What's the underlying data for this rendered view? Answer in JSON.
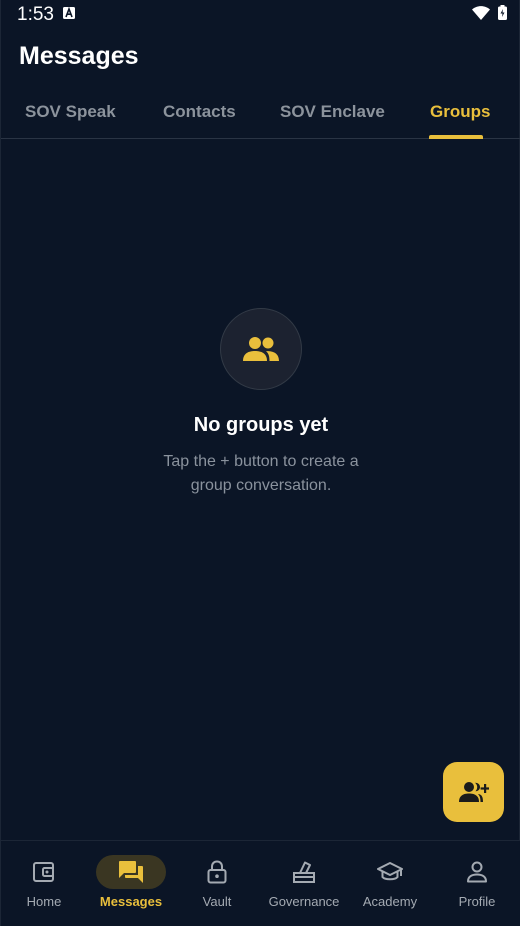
{
  "status_bar": {
    "time": "1:53",
    "icons": [
      "a-notification-icon",
      "wifi-icon",
      "battery-icon"
    ]
  },
  "header": {
    "title": "Messages"
  },
  "tabs": [
    {
      "label": "SOV Speak",
      "active": false
    },
    {
      "label": "Contacts",
      "active": false
    },
    {
      "label": "SOV Enclave",
      "active": false
    },
    {
      "label": "Groups",
      "active": true
    }
  ],
  "empty_state": {
    "icon": "groups-icon",
    "title": "No groups yet",
    "subtitle": "Tap the + button to create a group conversation."
  },
  "fab": {
    "icon": "add-group-icon"
  },
  "bottom_nav": [
    {
      "label": "Home",
      "icon": "wallet-icon",
      "active": false
    },
    {
      "label": "Messages",
      "icon": "chat-icon",
      "active": true
    },
    {
      "label": "Vault",
      "icon": "lock-icon",
      "active": false
    },
    {
      "label": "Governance",
      "icon": "vote-icon",
      "active": false
    },
    {
      "label": "Academy",
      "icon": "graduation-cap-icon",
      "active": false
    },
    {
      "label": "Profile",
      "icon": "person-icon",
      "active": false
    }
  ],
  "colors": {
    "background": "#0b1526",
    "accent": "#e9bf3c",
    "muted_text": "#8c939c",
    "nav_active_bg": "#3a3622"
  }
}
